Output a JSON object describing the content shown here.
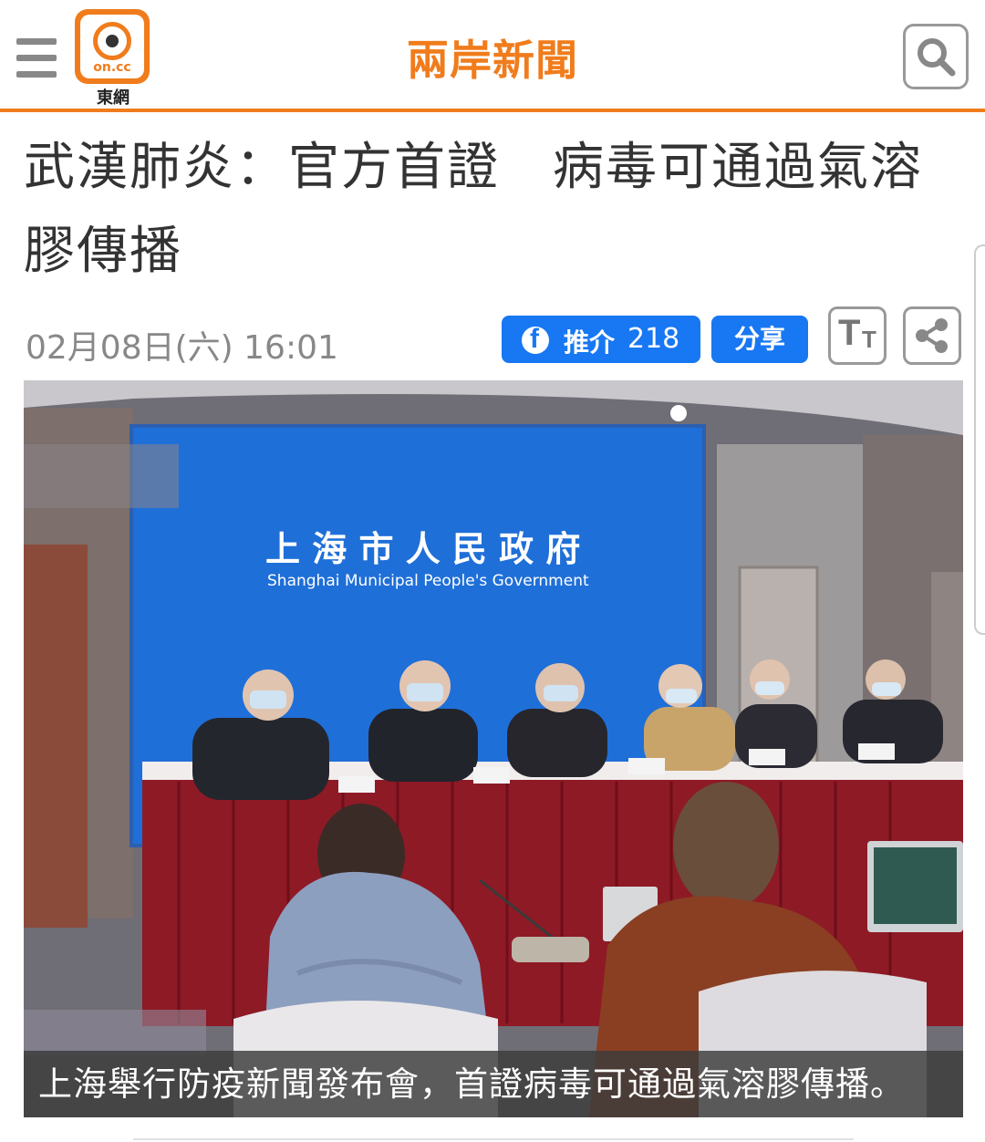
{
  "header": {
    "logo_text": "on.cc",
    "logo_subtitle": "東網",
    "section_title": "兩岸新聞",
    "menu_icon": "hamburger-menu-icon",
    "search_icon": "search-icon",
    "accent_color": "#f07c1c"
  },
  "article": {
    "headline": "武漢肺炎：官方首證　病毒可通過氣溶膠傳播",
    "date": "02月08日(六) 16:01",
    "facebook": {
      "label": "推介",
      "count": "218",
      "color": "#1877f2"
    },
    "share_label": "分享",
    "font_size_button": {
      "big": "T",
      "small": "T"
    },
    "share_icon": "share-icon"
  },
  "photo": {
    "backdrop_title_cn": "上 海 市 人 民 政 府",
    "backdrop_title_en": "Shanghai Municipal People's Government",
    "caption": "上海舉行防疫新聞發布會，首證病毒可通過氣溶膠傳播。"
  }
}
